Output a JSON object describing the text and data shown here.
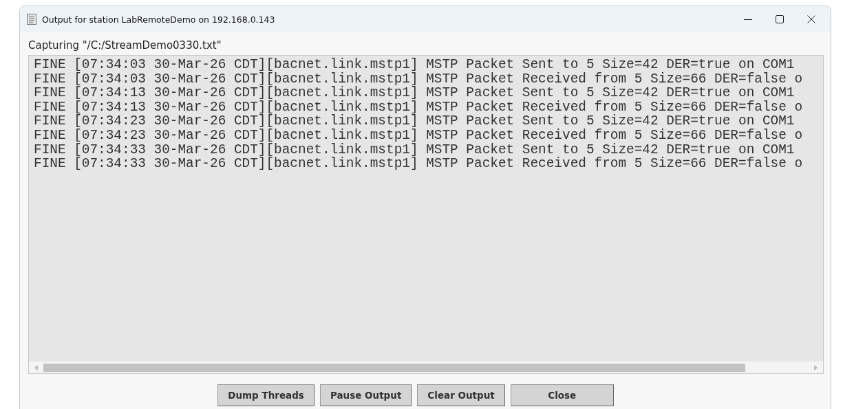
{
  "window": {
    "title": "Output for station LabRemoteDemo on 192.168.0.143"
  },
  "capture_label": "Capturing \"/C:/StreamDemo0330.txt\"",
  "log_lines": [
    "FINE [07:34:03 30-Mar-26 CDT][bacnet.link.mstp1] MSTP Packet Sent to 5 Size=42 DER=true on COM1",
    "FINE [07:34:03 30-Mar-26 CDT][bacnet.link.mstp1] MSTP Packet Received from 5 Size=66 DER=false o",
    "FINE [07:34:13 30-Mar-26 CDT][bacnet.link.mstp1] MSTP Packet Sent to 5 Size=42 DER=true on COM1",
    "FINE [07:34:13 30-Mar-26 CDT][bacnet.link.mstp1] MSTP Packet Received from 5 Size=66 DER=false o",
    "FINE [07:34:23 30-Mar-26 CDT][bacnet.link.mstp1] MSTP Packet Sent to 5 Size=42 DER=true on COM1",
    "FINE [07:34:23 30-Mar-26 CDT][bacnet.link.mstp1] MSTP Packet Received from 5 Size=66 DER=false o",
    "FINE [07:34:33 30-Mar-26 CDT][bacnet.link.mstp1] MSTP Packet Sent to 5 Size=42 DER=true on COM1",
    "FINE [07:34:33 30-Mar-26 CDT][bacnet.link.mstp1] MSTP Packet Received from 5 Size=66 DER=false o"
  ],
  "buttons": [
    "Dump Threads",
    "Pause Output",
    "Clear Output",
    "Close"
  ]
}
